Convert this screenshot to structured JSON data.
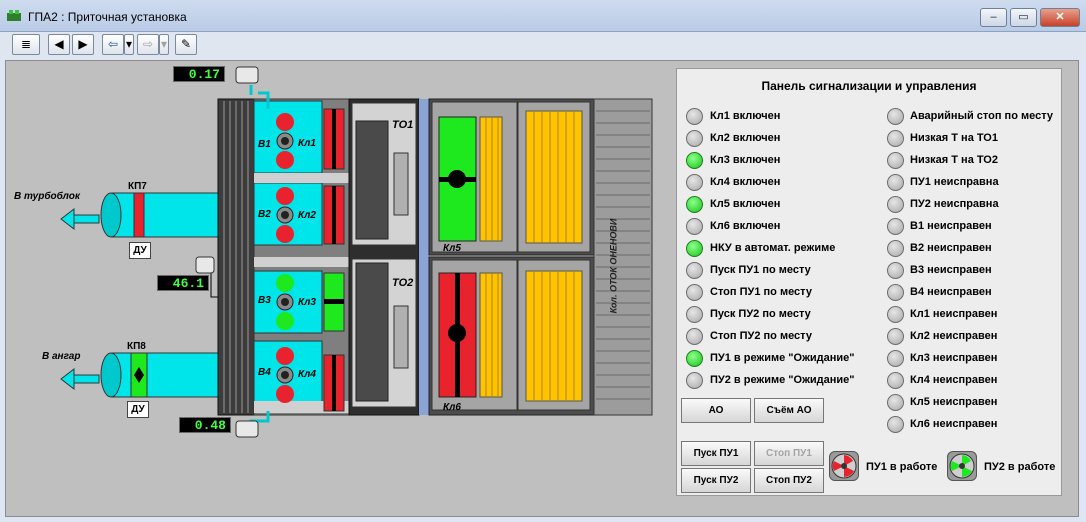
{
  "window": {
    "title": "ГПА2 : Приточная установка",
    "minimize": "‒",
    "maximize": "▭",
    "close": "✕"
  },
  "toolbar": {
    "menu": "≣",
    "prev": "◀",
    "next": "▶",
    "back": "⇦",
    "forward": "⇨",
    "dropdown": "▾",
    "pin": "✎"
  },
  "readings": {
    "top": "0.17",
    "middle": "46.1",
    "bottom": "0.48"
  },
  "labels": {
    "turboblock": "В турбоблок",
    "hangar": "В ангар",
    "kp7": "КП7",
    "kp8": "КП8",
    "du": "ДУ",
    "v1": "В1",
    "v2": "В2",
    "v3": "В3",
    "v4": "В4",
    "kl1": "Кл1",
    "kl2": "Кл2",
    "kl3": "Кл3",
    "kl4": "Кл4",
    "kl5": "Кл5",
    "kl6": "Кл6",
    "to1": "ТО1",
    "to2": "ТО2",
    "vertical": "Кол. ОТОК ОНЕНОВИ"
  },
  "panel": {
    "title": "Панель сигнализации и управления",
    "left": [
      {
        "label": "Кл1 включен",
        "state": "off"
      },
      {
        "label": "Кл2 включен",
        "state": "off"
      },
      {
        "label": "Кл3 включен",
        "state": "on"
      },
      {
        "label": "Кл4 включен",
        "state": "off"
      },
      {
        "label": "Кл5 включен",
        "state": "on"
      },
      {
        "label": "Кл6 включен",
        "state": "off"
      },
      {
        "label": "НКУ в автомат. режиме",
        "state": "on"
      },
      {
        "label": "Пуск ПУ1 по месту",
        "state": "off"
      },
      {
        "label": "Стоп ПУ1 по месту",
        "state": "off"
      },
      {
        "label": "Пуск ПУ2 по месту",
        "state": "off"
      },
      {
        "label": "Стоп ПУ2 по месту",
        "state": "off"
      },
      {
        "label": "ПУ1 в режиме \"Ожидание\"",
        "state": "on"
      },
      {
        "label": "ПУ2 в режиме \"Ожидание\"",
        "state": "off"
      }
    ],
    "right": [
      {
        "label": "Аварийный стоп по месту",
        "state": "off"
      },
      {
        "label": "Низкая Т на ТО1",
        "state": "off"
      },
      {
        "label": "Низкая Т на ТО2",
        "state": "off"
      },
      {
        "label": "ПУ1 неисправна",
        "state": "off"
      },
      {
        "label": "ПУ2 неисправна",
        "state": "off"
      },
      {
        "label": "В1 неисправен",
        "state": "off"
      },
      {
        "label": "В2 неисправен",
        "state": "off"
      },
      {
        "label": "В3 неисправен",
        "state": "off"
      },
      {
        "label": "В4 неисправен",
        "state": "off"
      },
      {
        "label": "Кл1 неисправен",
        "state": "off"
      },
      {
        "label": "Кл2 неисправен",
        "state": "off"
      },
      {
        "label": "Кл3 неисправен",
        "state": "off"
      },
      {
        "label": "Кл4 неисправен",
        "state": "off"
      },
      {
        "label": "Кл5 неисправен",
        "state": "off"
      },
      {
        "label": "Кл6 неисправен",
        "state": "off"
      }
    ],
    "buttons": {
      "ao": "АО",
      "ao_reset": "Съём АО",
      "start_pu1": "Пуск ПУ1",
      "stop_pu1": "Стоп ПУ1",
      "start_pu2": "Пуск ПУ2",
      "stop_pu2": "Стоп ПУ2"
    },
    "status": {
      "pu1": "ПУ1 в работе",
      "pu2": "ПУ2 в работе"
    }
  },
  "colors": {
    "on": "#16c516",
    "off": "#a7a7a7",
    "cyan": "#00e5ea",
    "red": "#e8232d",
    "green": "#1ee81e",
    "yellow": "#ffc400"
  }
}
